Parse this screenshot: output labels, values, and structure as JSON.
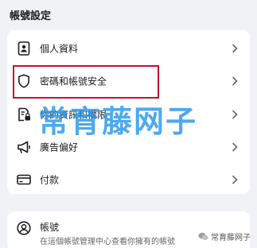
{
  "header": {
    "title": "帳號設定"
  },
  "settings_items": [
    {
      "label": "個人資料",
      "icon": "id-card-icon"
    },
    {
      "label": "密碼和帳號安全",
      "icon": "shield-icon"
    },
    {
      "label": "你的資訊和權限",
      "icon": "document-lock-icon"
    },
    {
      "label": "廣告偏好",
      "icon": "megaphone-icon"
    },
    {
      "label": "付款",
      "icon": "credit-card-icon"
    }
  ],
  "account_card": {
    "title": "帳號",
    "description": "在這個帳號管理中心查看你擁有的帳號"
  },
  "watermark": "常育藤网子",
  "wechat_label": "常育藤网子",
  "colors": {
    "highlight": "#c8102e",
    "watermark": "#2696eb",
    "background": "#f0f2f5"
  }
}
